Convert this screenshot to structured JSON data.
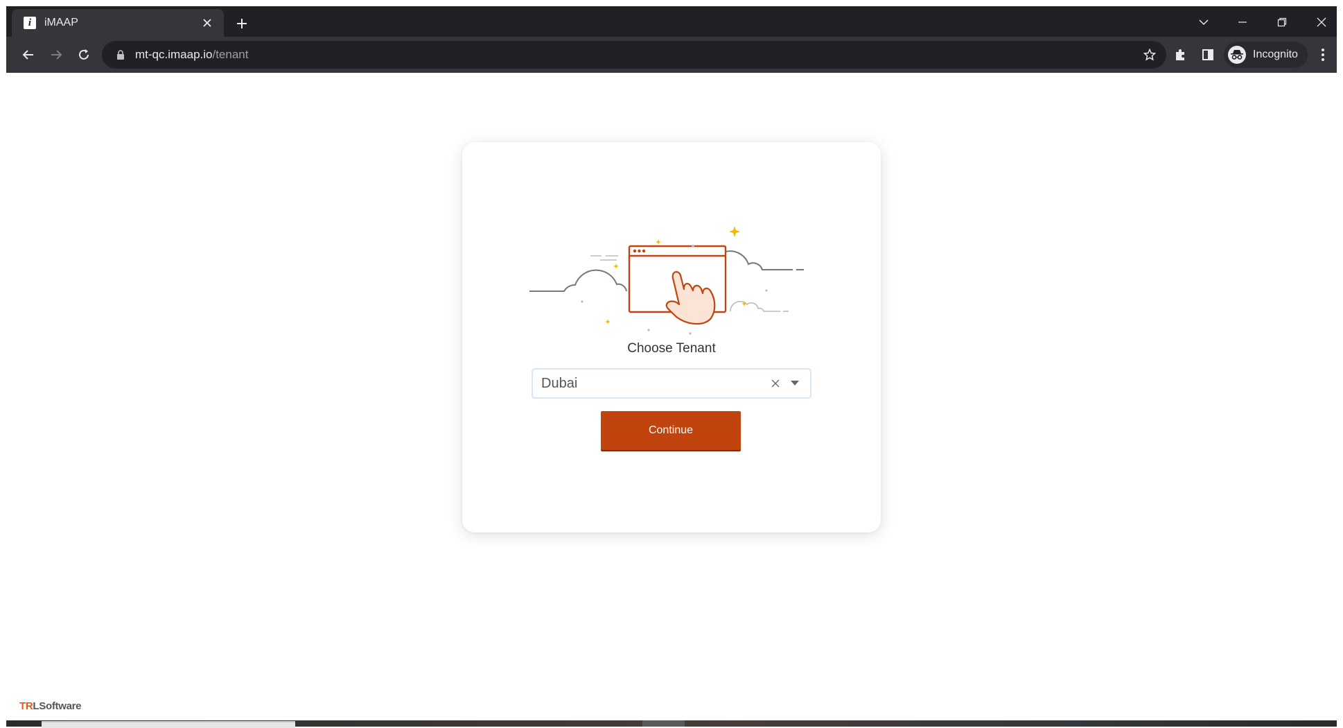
{
  "browser": {
    "tab": {
      "title": "iMAAP",
      "favicon_letter": "i"
    },
    "url": {
      "host": "mt-qc.imaap.io",
      "path": "/tenant"
    },
    "profile_label": "Incognito"
  },
  "page": {
    "title": "Choose Tenant",
    "tenant_select": {
      "value": "Dubai"
    },
    "continue_label": "Continue",
    "accent_color": "#c1440e"
  },
  "footer": {
    "logo_tr": "TR",
    "logo_rl": "L",
    "logo_rest": "Software"
  }
}
